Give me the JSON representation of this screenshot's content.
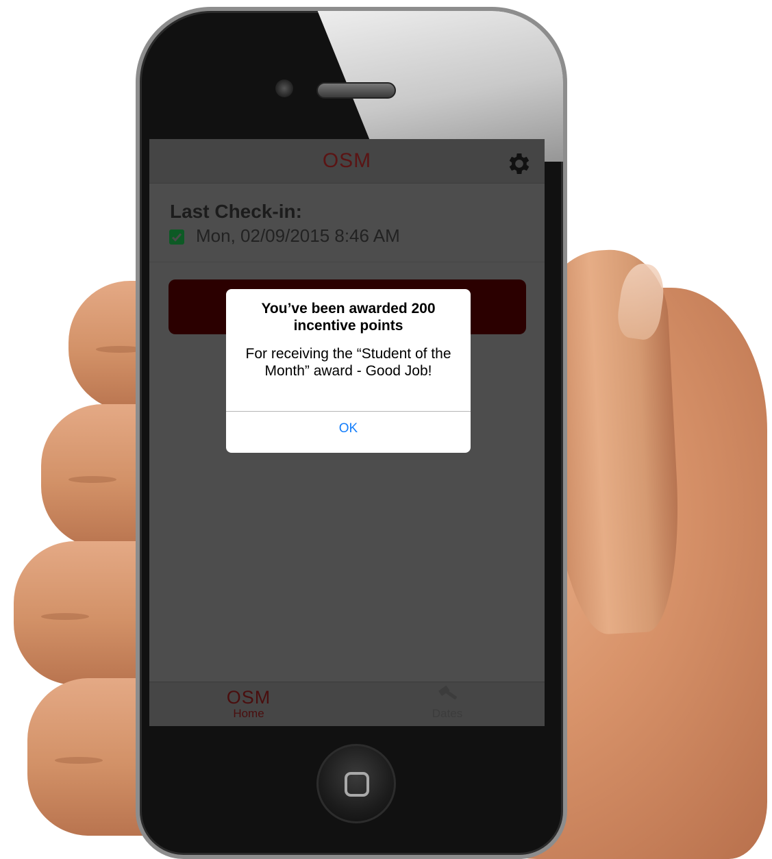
{
  "app": {
    "title": "OSM"
  },
  "header": {
    "settings_icon": "gear-icon"
  },
  "last_checkin": {
    "heading": "Last Check-in:",
    "status_icon": "checkbox-checked-icon",
    "date": "Mon, 02/09/2015 8:46 AM"
  },
  "alert": {
    "title": "You’ve been awarded 200 incentive points",
    "message": "For receiving the “Student of the Month” award - Good Job!",
    "ok_label": "OK"
  },
  "tabbar": {
    "home": {
      "logo": "OSM",
      "label": "Home"
    },
    "dates": {
      "icon": "gavel-icon",
      "label": "Dates"
    }
  },
  "colors": {
    "brand": "#5a1414",
    "action_bar": "#2b0000",
    "link_blue": "#147efb",
    "check_green": "#0d5a25"
  }
}
